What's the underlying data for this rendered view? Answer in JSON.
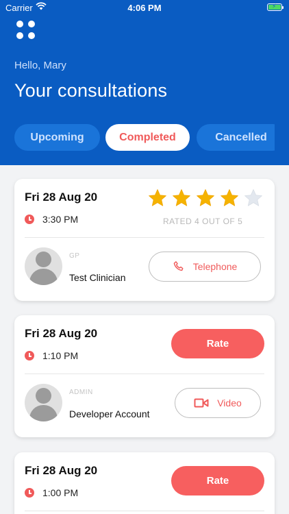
{
  "status_bar": {
    "carrier": "Carrier",
    "time": "4:06 PM"
  },
  "header": {
    "greeting": "Hello, Mary",
    "title": "Your consultations",
    "tabs": [
      {
        "label": "Upcoming",
        "active": false
      },
      {
        "label": "Completed",
        "active": true
      },
      {
        "label": "Cancelled",
        "active": false
      }
    ]
  },
  "colors": {
    "brand_blue": "#0a5cc2",
    "accent_red": "#f05a5a",
    "star_gold": "#f5b300"
  },
  "consultations": [
    {
      "date": "Fri 28 Aug 20",
      "time": "3:30 PM",
      "rating": 4,
      "rating_max": 5,
      "rating_text": "RATED 4 OUT OF 5",
      "role": "GP",
      "clinician": "Test Clinician",
      "type_label": "Telephone",
      "type_icon": "phone-icon"
    },
    {
      "date": "Fri 28 Aug 20",
      "time": "1:10 PM",
      "rate_label": "Rate",
      "role": "ADMIN",
      "clinician": "Developer Account",
      "type_label": "Video",
      "type_icon": "video-icon"
    },
    {
      "date": "Fri 28 Aug 20",
      "time": "1:00 PM",
      "rate_label": "Rate"
    }
  ]
}
